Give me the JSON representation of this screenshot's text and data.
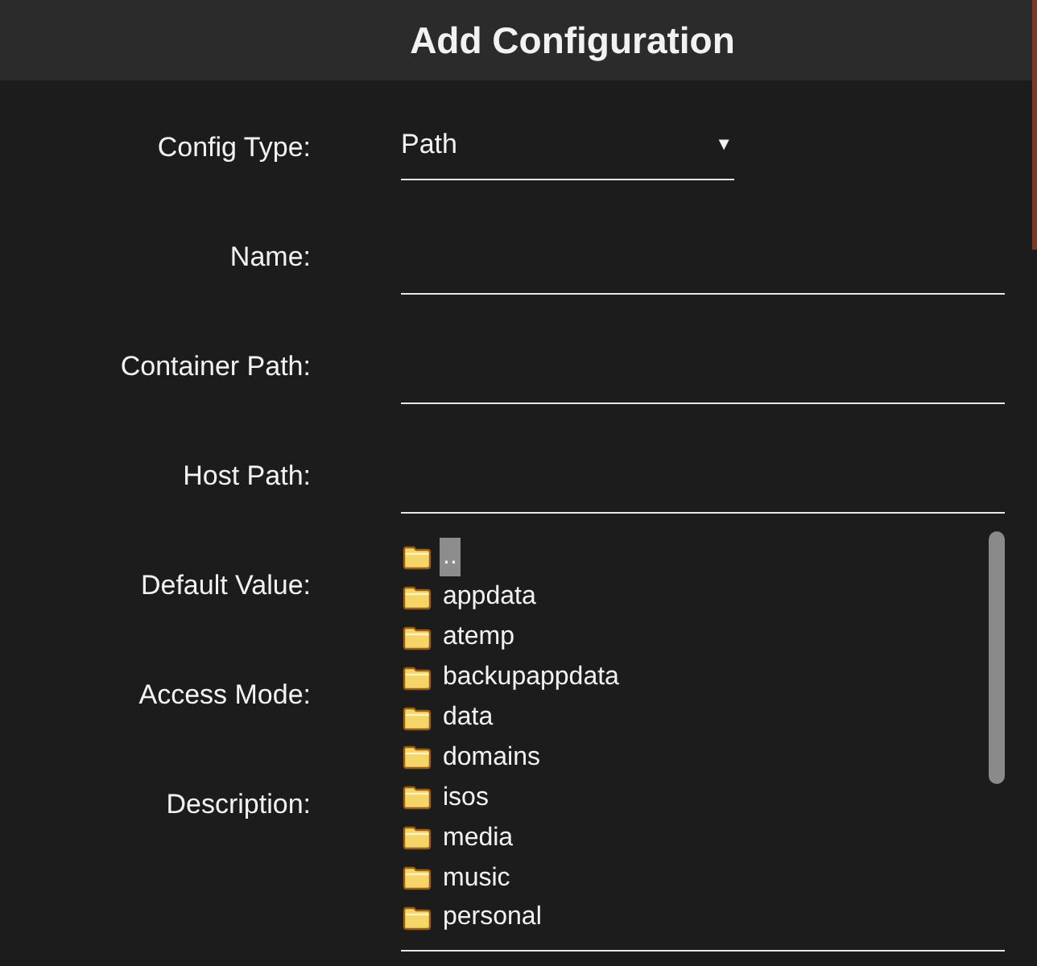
{
  "dialog": {
    "title": "Add Configuration"
  },
  "fields": [
    {
      "label": "Config Type:",
      "kind": "select",
      "value": "Path",
      "arrow": "▼"
    },
    {
      "label": "Name:",
      "kind": "text"
    },
    {
      "label": "Container Path:",
      "kind": "text"
    },
    {
      "label": "Host Path:",
      "kind": "text"
    },
    {
      "label": "Default Value:",
      "kind": "covered"
    },
    {
      "label": "Access Mode:",
      "kind": "covered"
    },
    {
      "label": "Description:",
      "kind": "covered"
    }
  ],
  "file_browser": {
    "items": [
      {
        "name": "..",
        "selected": true
      },
      {
        "name": "appdata",
        "selected": false
      },
      {
        "name": "atemp",
        "selected": false
      },
      {
        "name": "backupappdata",
        "selected": false
      },
      {
        "name": "data",
        "selected": false
      },
      {
        "name": "domains",
        "selected": false
      },
      {
        "name": "isos",
        "selected": false
      },
      {
        "name": "media",
        "selected": false
      },
      {
        "name": "music",
        "selected": false
      },
      {
        "name": "personal",
        "selected": false
      }
    ]
  }
}
